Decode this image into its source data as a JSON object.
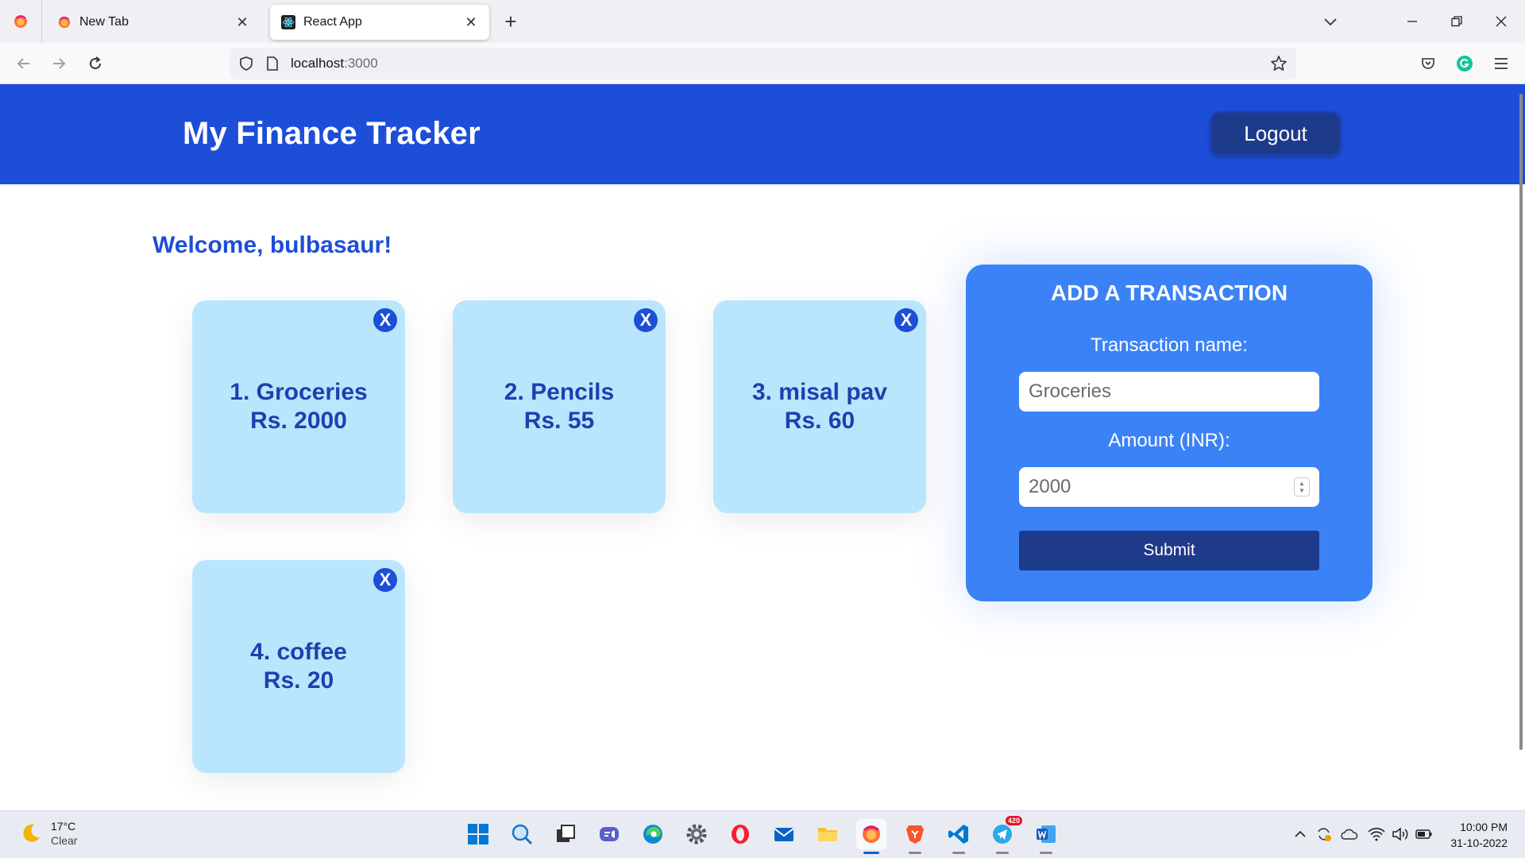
{
  "browser": {
    "tabs": [
      {
        "title": "New Tab",
        "active": false
      },
      {
        "title": "React App",
        "active": true
      }
    ],
    "url_host": "localhost",
    "url_port": ":3000"
  },
  "app": {
    "title": "My Finance Tracker",
    "logout_label": "Logout",
    "welcome": "Welcome, bulbasaur!",
    "delete_label": "X",
    "transactions": [
      {
        "name": "1. Groceries",
        "amount": "Rs. 2000"
      },
      {
        "name": "2. Pencils",
        "amount": "Rs. 55"
      },
      {
        "name": "3. misal pav",
        "amount": "Rs. 60"
      },
      {
        "name": "4. coffee",
        "amount": "Rs. 20"
      }
    ],
    "form": {
      "title": "ADD A TRANSACTION",
      "name_label": "Transaction name:",
      "name_placeholder": "Groceries",
      "amount_label": "Amount (INR):",
      "amount_placeholder": "2000",
      "submit_label": "Submit"
    }
  },
  "taskbar": {
    "weather_temp": "17°C",
    "weather_cond": "Clear",
    "telegram_badge": "420",
    "time": "10:00 PM",
    "date": "31-10-2022"
  },
  "colors": {
    "header": "#1d4ed8",
    "card": "#bae6fd",
    "panel": "#3b82f6",
    "button_dark": "#1e3a8a"
  }
}
